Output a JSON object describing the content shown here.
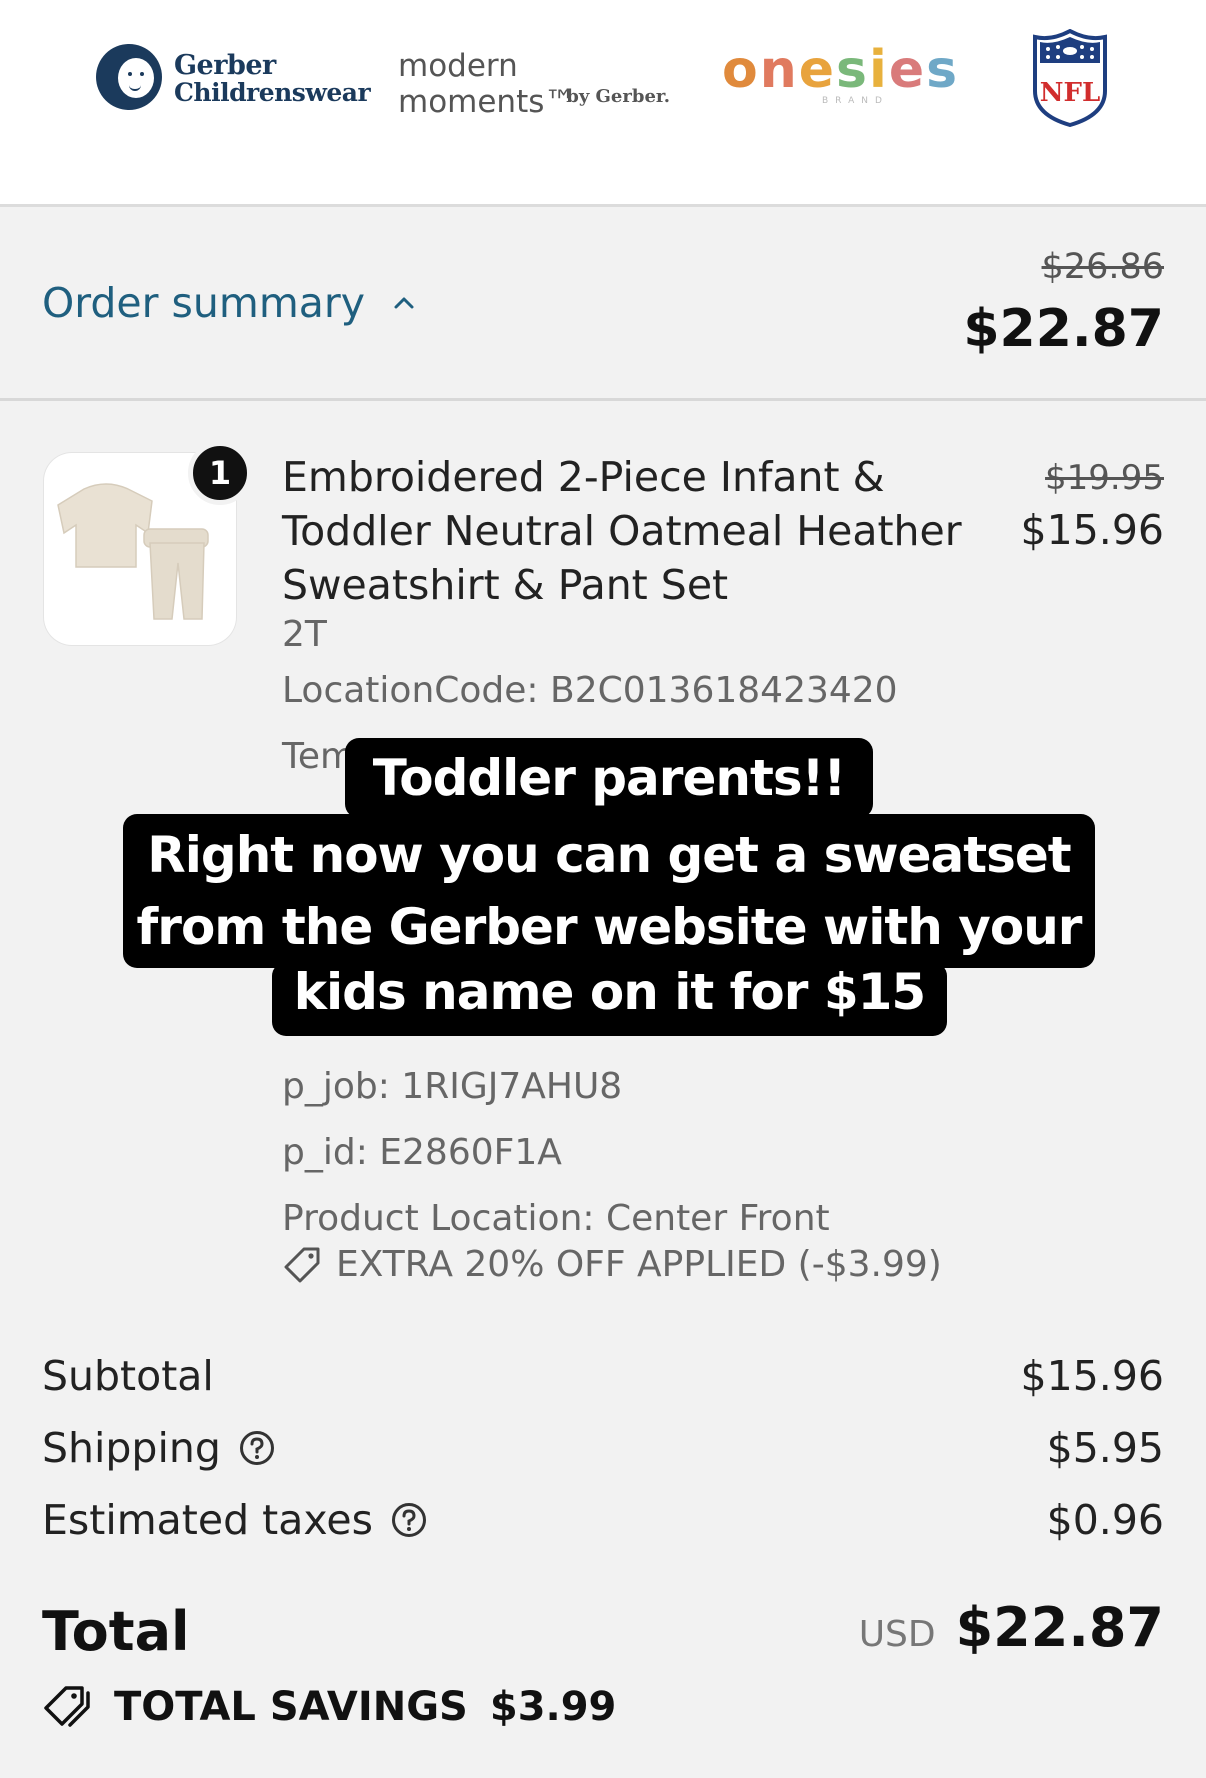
{
  "brands": {
    "gerber_line1": "Gerber",
    "gerber_line2": "Childrenswear",
    "modern_moments": "modern moments™",
    "modern_moments_by": "by Gerber.",
    "onesies": [
      "o",
      "n",
      "e",
      "s",
      "i",
      "e",
      "s"
    ],
    "onesies_colors": [
      "#e08a3c",
      "#e07a5f",
      "#e8a33d",
      "#7ab87a",
      "#e8b13d",
      "#d97b7b",
      "#6fa8c7"
    ],
    "onesies_sub": "BRAND",
    "nfl": "NFL"
  },
  "summary": {
    "toggle_label": "Order summary",
    "original_total": "$26.86",
    "total": "$22.87"
  },
  "item": {
    "quantity": "1",
    "title": "Embroidered 2-Piece Infant & Toddler Neutral Oatmeal Heather Sweatshirt & Pant Set",
    "original_price": "$19.95",
    "price": "$15.96",
    "size": "2T",
    "location_code": "LocationCode: B2C013618423420",
    "partial_line": "Tem",
    "p_job": "p_job: 1RIGJ7AHU8",
    "p_id": "p_id: E2860F1A",
    "product_location": "Product Location: Center Front",
    "discount": "EXTRA 20% OFF APPLIED (-$3.99)"
  },
  "caption": {
    "line1": "Toddler parents!!",
    "line2": "Right now you can get a sweatset",
    "line3": "from the Gerber website with your",
    "line4": "kids name on it for $15"
  },
  "totals": {
    "subtotal_label": "Subtotal",
    "subtotal": "$15.96",
    "shipping_label": "Shipping",
    "shipping": "$5.95",
    "taxes_label": "Estimated taxes",
    "taxes": "$0.96",
    "total_label": "Total",
    "currency": "USD",
    "total": "$22.87",
    "savings_label": "TOTAL SAVINGS",
    "savings": "$3.99"
  },
  "colors": {
    "accent": "#1f5f7f",
    "background": "#f2f2f2"
  }
}
